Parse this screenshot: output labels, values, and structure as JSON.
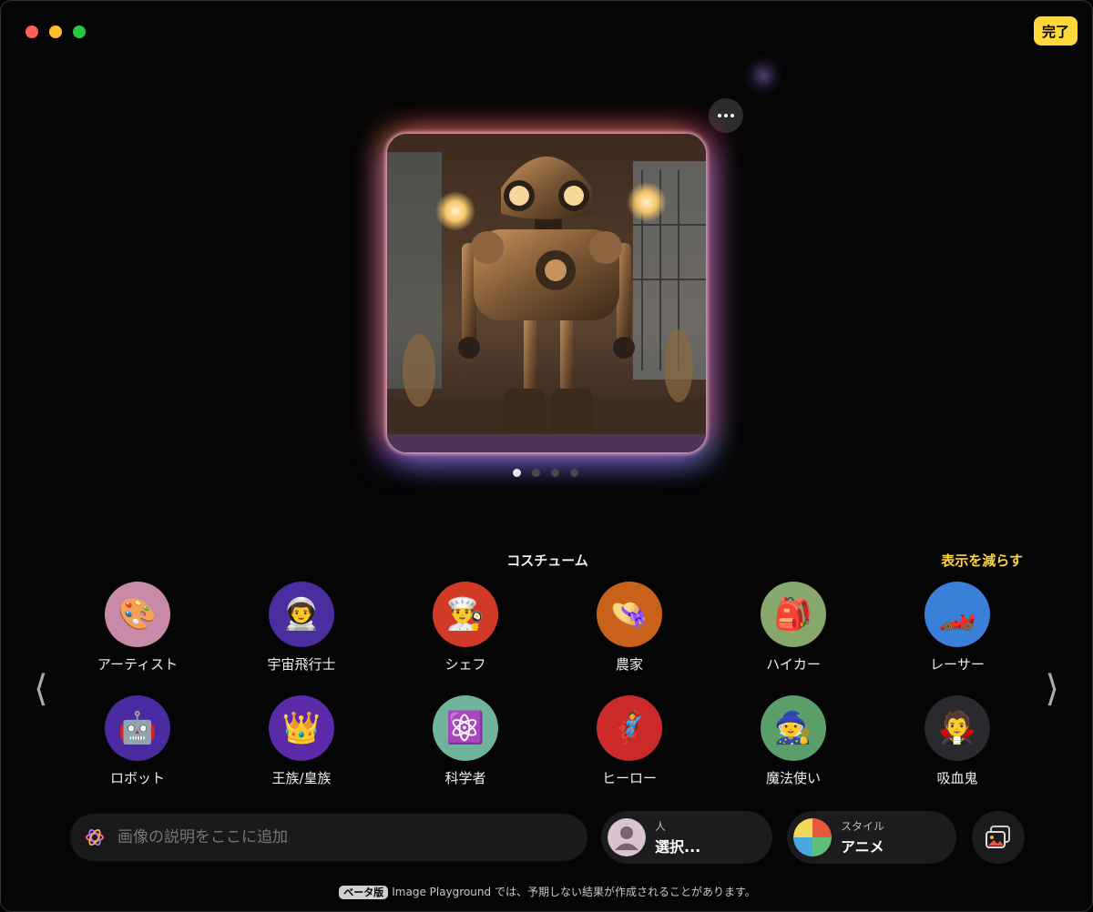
{
  "header": {
    "done_label": "完了"
  },
  "preview": {
    "pages": 4,
    "active_page": 1
  },
  "section": {
    "title": "コスチューム",
    "toggle_label": "表示を減らす"
  },
  "items": [
    {
      "label": "アーティスト",
      "icon": "🎨",
      "color": "#c88aa8"
    },
    {
      "label": "宇宙飛行士",
      "icon": "👨‍🚀",
      "color": "#4a2ea0"
    },
    {
      "label": "シェフ",
      "icon": "👨‍🍳",
      "color": "#d13a26"
    },
    {
      "label": "農家",
      "icon": "👒",
      "color": "#c8621a"
    },
    {
      "label": "ハイカー",
      "icon": "🎒",
      "color": "#86a86c"
    },
    {
      "label": "レーサー",
      "icon": "🏎️",
      "color": "#3a7fd8"
    },
    {
      "label": "ロボット",
      "icon": "🤖",
      "color": "#4a2aa0"
    },
    {
      "label": "王族/皇族",
      "icon": "👑",
      "color": "#5a2aa8"
    },
    {
      "label": "科学者",
      "icon": "⚛️",
      "color": "#6fb39a"
    },
    {
      "label": "ヒーロー",
      "icon": "🦸",
      "color": "#cc2a2a"
    },
    {
      "label": "魔法使い",
      "icon": "🧙",
      "color": "#5c9e6a"
    },
    {
      "label": "吸血鬼",
      "icon": "🧛",
      "color": "#2a2a2e"
    }
  ],
  "prompt": {
    "placeholder": "画像の説明をここに追加"
  },
  "person_pill": {
    "small": "人",
    "big": "選択..."
  },
  "style_pill": {
    "small": "スタイル",
    "big": "アニメ"
  },
  "footer": {
    "badge": "ベータ版",
    "text": "Image Playground では、予期しない結果が作成されることがあります。"
  }
}
